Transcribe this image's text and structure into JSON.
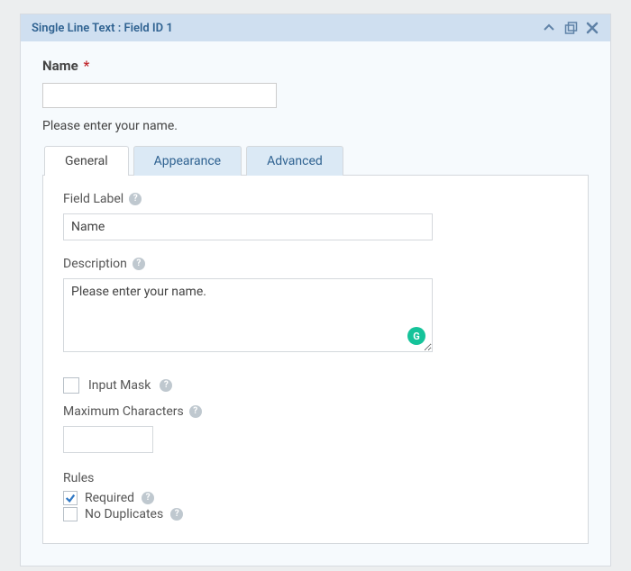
{
  "header": {
    "title": "Single Line Text : Field ID 1"
  },
  "preview": {
    "label": "Name",
    "required_marker": "*",
    "description": "Please enter your name."
  },
  "tabs": {
    "general": "General",
    "appearance": "Appearance",
    "advanced": "Advanced"
  },
  "general": {
    "field_label_caption": "Field Label",
    "field_label_value": "Name",
    "description_caption": "Description",
    "description_value": "Please enter your name.",
    "input_mask_label": "Input Mask",
    "max_chars_label": "Maximum Characters",
    "max_chars_value": "",
    "rules_caption": "Rules",
    "rule_required": "Required",
    "rule_noduplicates": "No Duplicates"
  },
  "help_glyph": "?",
  "grammarly_glyph": "G"
}
